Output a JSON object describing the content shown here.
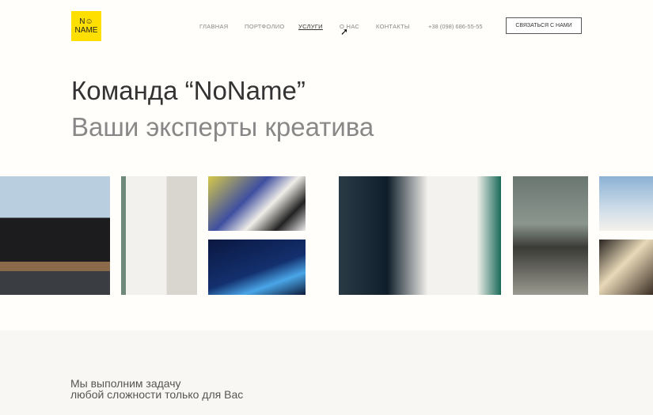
{
  "logo": {
    "line1": "N☺",
    "line2": "NAME"
  },
  "nav": {
    "items": [
      "ГЛАВНАЯ",
      "ПОРТФОЛИО",
      "УСЛУГИ",
      "О НАС",
      "КОНТАКТЫ"
    ],
    "active": "УСЛУГИ"
  },
  "phone": "+38 (098) 686-55-55",
  "cta": "СВЯЗАТЬСЯ С НАМИ",
  "hero": {
    "title": "Команда “NoName”",
    "subtitle": "Ваши эксперты креатива"
  },
  "tagline": {
    "line1": "Мы выполним задачу",
    "line2": "любой сложности только для Вас"
  }
}
